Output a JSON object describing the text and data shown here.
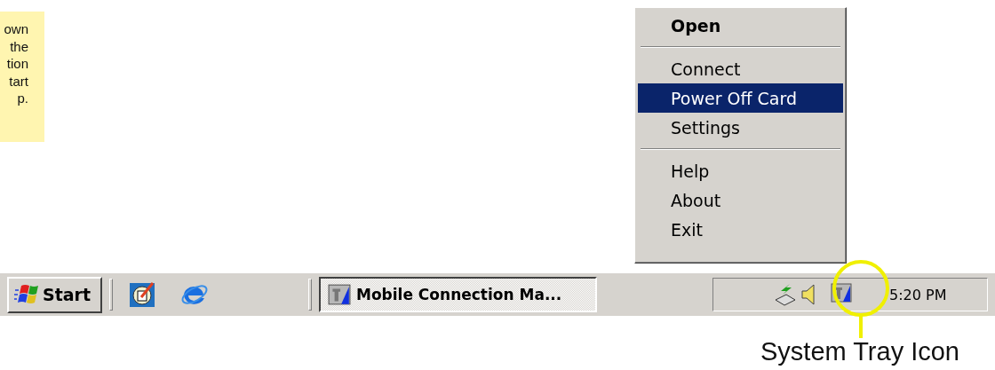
{
  "note": {
    "lines": [
      "own",
      "the",
      "tion",
      "tart",
      "p."
    ]
  },
  "menu": {
    "items": [
      {
        "kind": "item",
        "label": "Open",
        "default": true,
        "selected": false
      },
      {
        "kind": "separator"
      },
      {
        "kind": "item",
        "label": "Connect",
        "default": false,
        "selected": false
      },
      {
        "kind": "item",
        "label": "Power Off Card",
        "default": false,
        "selected": true
      },
      {
        "kind": "item",
        "label": "Settings",
        "default": false,
        "selected": false
      },
      {
        "kind": "separator"
      },
      {
        "kind": "item",
        "label": "Help",
        "default": false,
        "selected": false
      },
      {
        "kind": "item",
        "label": "About",
        "default": false,
        "selected": false
      },
      {
        "kind": "item",
        "label": "Exit",
        "default": false,
        "selected": false
      }
    ]
  },
  "taskbar": {
    "start": {
      "label": "Start"
    },
    "task": {
      "label": "Mobile Connection Ma...",
      "selected": true
    },
    "tray": {
      "time": "5:20 PM"
    }
  },
  "callout": {
    "label": "System Tray Icon"
  }
}
